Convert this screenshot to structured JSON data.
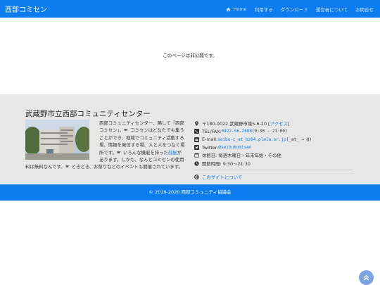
{
  "navbar": {
    "brand": "西部コミセン",
    "items": [
      "Home",
      "利用する",
      "ダウンロード",
      "運営者について",
      "お問合せ"
    ]
  },
  "main": {
    "message": "このページは非公開です。"
  },
  "info": {
    "title": "武蔵野市立西部コミュニティセンター",
    "desc_1": "西部コミュニティセンター、略して「西部コミセン」。",
    "desc_2": "コミセンはどなたでも集うことができ、地域でコミュニティ活動する場、情報を発信する場、人と人をつなぐ場所です。",
    "desc_3": "いろんな機能を持った",
    "desc_link": "部屋",
    "desc_4": "があります。しかも、なんとコミセンの使用料は無料なんです。",
    "desc_5": "ときどき、お祭りなどのイベントも開催されています。",
    "address": "〒180-0022 武蔵野市境5-6-20 [",
    "access": "アクセス",
    "address_end": "]",
    "tel_label": "TEL/FAX: ",
    "tel": "0422-56-2888",
    "tel_hours": " (9:30 - 21:00)",
    "email_label": "E-mail: ",
    "email": "seibu-c_at_bz04.plala.or.jp",
    "email_note": " (_at_ → @)",
    "twitter_label": "Twitter: ",
    "twitter": "@seibukomisen",
    "closed": "休館日: 毎週木曜日・年末年始・その他",
    "hours": "開館時間: 9:30～21:30",
    "about": "このサイトについて"
  },
  "footer": {
    "copyright": "© 2019-2020 西部コミュニティ協議会"
  },
  "colors": {
    "primary": "#0d7cf0",
    "info_bg": "#e7e7e7",
    "totop": "#7aa5e2"
  },
  "icons": [
    "home-icon",
    "info-circle-icon",
    "map-marker-icon",
    "phone-icon",
    "envelope-icon",
    "twitter-square-icon",
    "calendar-icon",
    "clock-icon",
    "globe-icon",
    "chevron-up-icon"
  ]
}
